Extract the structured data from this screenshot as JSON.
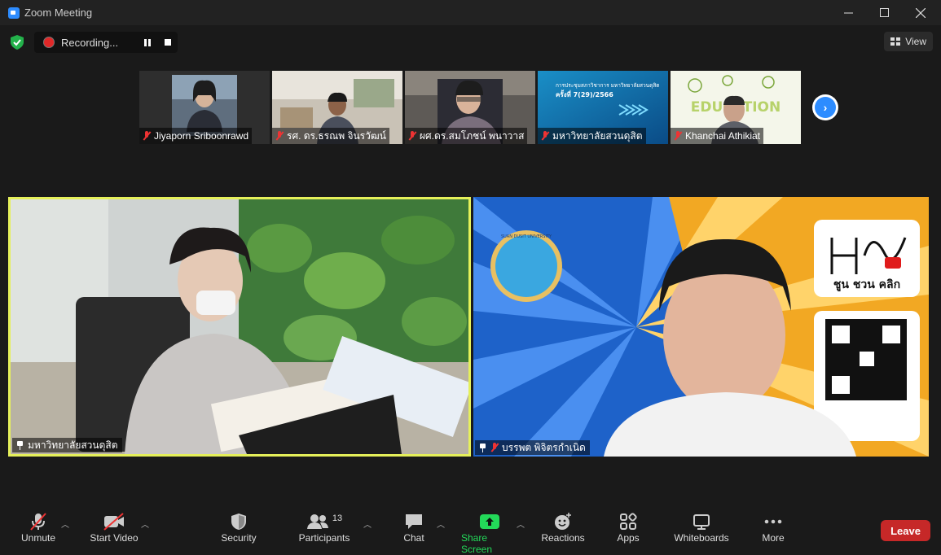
{
  "window": {
    "title": "Zoom Meeting"
  },
  "recording": {
    "label": "Recording..."
  },
  "view": {
    "label": "View"
  },
  "thumbnails": [
    {
      "name": "Jiyaporn Sriboonrawd"
    },
    {
      "name": "รศ. ดร.ธรณพ จินรวัฒน์"
    },
    {
      "name": "ผศ.ดร.สมโภชน์ พนาวาส"
    },
    {
      "name": "มหาวิทยาลัยสวนดุสิต",
      "slide": {
        "line1": "การประชุมสภาวิชาการ มหาวิทยาลัยสวนดุสิต",
        "line2": "ครั้งที่ 7(29)/2566"
      }
    },
    {
      "name": "Khanchai Athikiat",
      "banner": "EDUCATION"
    }
  ],
  "main_tiles": [
    {
      "name": "มหาวิทยาลัยสวนดุสิต"
    },
    {
      "name": "บรรพต พิจิตรกำเนิด",
      "logo_text": "SUAN DUSIT UNIVERSITY",
      "brand": "ชูน ชวน คลิก"
    }
  ],
  "toolbar": {
    "unmute": "Unmute",
    "start_video": "Start Video",
    "security": "Security",
    "participants": "Participants",
    "participants_count": "13",
    "chat": "Chat",
    "share_screen": "Share Screen",
    "reactions": "Reactions",
    "apps": "Apps",
    "whiteboards": "Whiteboards",
    "more": "More",
    "leave": "Leave"
  },
  "colors": {
    "accent": "#2d8cff",
    "share": "#23d959",
    "leave": "#c62828",
    "speaker_border": "#e5f05a",
    "muted": "#e33333"
  }
}
